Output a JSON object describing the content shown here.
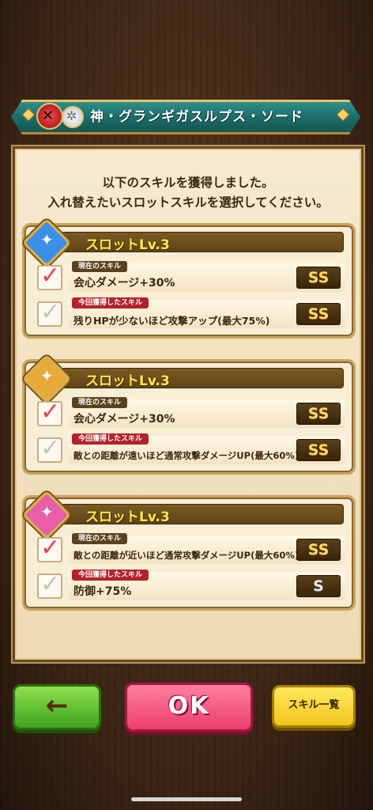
{
  "banner": {
    "title": "神・グランギガスルプス・ソード",
    "elem1_icon": "crossed-swords-icon",
    "elem2_icon": "gear-icon"
  },
  "intro": {
    "line1": "以下のスキルを獲得しました。",
    "line2": "入れ替えたいスロットスキルを選択してください。"
  },
  "slots": [
    {
      "title": "スロットLv.3",
      "icon_color": "#3b8fe8",
      "current": {
        "tag": "現在のスキル",
        "name": "会心ダメージ+30%",
        "rank": "SS",
        "checked": true
      },
      "new": {
        "tag": "今回獲得したスキル",
        "name": "残りHPが少ないほど攻撃アップ(最大75%)",
        "rank": "SS",
        "checked": false
      }
    },
    {
      "title": "スロットLv.3",
      "icon_color": "#e8a93b",
      "current": {
        "tag": "現在のスキル",
        "name": "会心ダメージ+30%",
        "rank": "SS",
        "checked": true
      },
      "new": {
        "tag": "今回獲得したスキル",
        "name": "敵との距離が遠いほど通常攻撃ダメージUP(最大60%)",
        "rank": "SS",
        "checked": false
      }
    },
    {
      "title": "スロットLv.3",
      "icon_color": "#e85ea8",
      "current": {
        "tag": "現在のスキル",
        "name": "敵との距離が近いほど通常攻撃ダメージUP(最大60%)",
        "rank": "SS",
        "checked": true
      },
      "new": {
        "tag": "今回獲得したスキル",
        "name": "防御+75%",
        "rank": "S",
        "checked": false
      }
    }
  ],
  "buttons": {
    "back": "←",
    "ok": "OK",
    "list": "スキル一覧"
  }
}
